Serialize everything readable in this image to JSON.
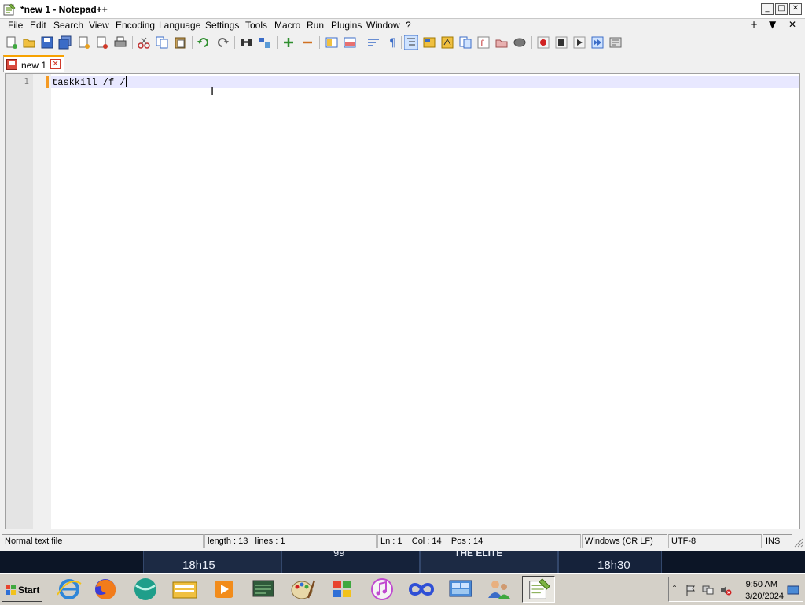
{
  "window": {
    "title": "*new 1 - Notepad++"
  },
  "menu": {
    "items": [
      "File",
      "Edit",
      "Search",
      "View",
      "Encoding",
      "Language",
      "Settings",
      "Tools",
      "Macro",
      "Run",
      "Plugins",
      "Window",
      "?"
    ],
    "right_controls": [
      "+",
      "▼",
      "✕"
    ]
  },
  "tabs": [
    {
      "label": "new 1",
      "active": true
    }
  ],
  "editor": {
    "line_number": "1",
    "line_text": "taskkill /f /"
  },
  "status": {
    "doc_type": "Normal text file",
    "length": "length : 13",
    "lines": "lines : 1",
    "position": "Ln : 1    Col : 14    Pos : 14",
    "eol": "Windows (CR LF)",
    "encoding": "UTF-8",
    "mode": "INS"
  },
  "background": {
    "texts": [
      "18h15",
      "99",
      "THE ELITE",
      "18h30"
    ]
  },
  "taskbar": {
    "start_label": "Start",
    "clock_time": "9:50 AM",
    "clock_date": "3/20/2024"
  },
  "colors": {
    "accent_tab": "#f7a200",
    "current_line": "#e8e8ff",
    "change_marker": "#f59a23"
  }
}
